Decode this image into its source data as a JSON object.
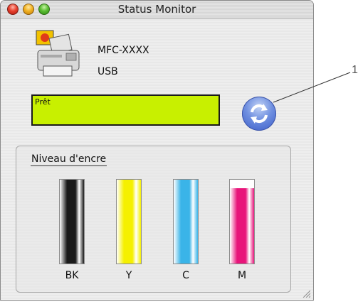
{
  "window": {
    "title": "Status Monitor"
  },
  "device": {
    "model": "MFC-XXXX",
    "connection": "USB"
  },
  "status": {
    "text": "Prêt",
    "color": "#c8f000"
  },
  "ink_panel": {
    "label": "Niveau d'encre",
    "cartridges": [
      {
        "label": "BK",
        "level": 1.0,
        "color": "#1a1a1a"
      },
      {
        "label": "Y",
        "level": 1.0,
        "color": "#f5f000"
      },
      {
        "label": "C",
        "level": 1.0,
        "color": "#3ab4e8"
      },
      {
        "label": "M",
        "level": 0.9,
        "color": "#e8147a"
      }
    ]
  },
  "callout": {
    "number": "1"
  },
  "icons": {
    "close": "close-icon",
    "minimize": "minimize-icon",
    "zoom": "zoom-icon",
    "printer": "printer-icon",
    "refresh": "refresh-icon",
    "resize": "resize-grip-icon"
  }
}
